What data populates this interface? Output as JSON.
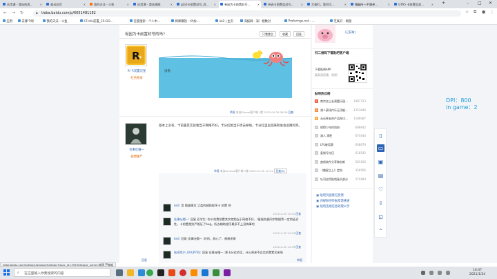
{
  "browser": {
    "tabs": [
      {
        "label": "应用课 - 我站的男…",
        "color": "#2e6fd6",
        "active": false
      },
      {
        "label": "驱动总页",
        "color": "#2e6fd6",
        "active": false
      },
      {
        "label": "我的天法 - 斗鱼",
        "color": "#ff6d00",
        "active": false
      },
      {
        "label": "应用课 - 我站观图",
        "color": "#2e6fd6",
        "active": false
      },
      {
        "label": "gta5卡前置封号_百…",
        "color": "#2e6fd6",
        "active": false
      },
      {
        "label": "有因为卡前置封号…",
        "color": "#2e6fd6",
        "active": true
      },
      {
        "label": "听说卡前置会封号…",
        "color": "#2e6fd6",
        "active": false
      },
      {
        "label": "大佬们，我问可…",
        "color": "#2e6fd6",
        "active": false
      },
      {
        "label": "镰鼬所一不属单…",
        "color": "#2e6fd6",
        "active": false
      },
      {
        "label": "GTA5 卡前置会封…",
        "color": "#2e6fd6",
        "active": false
      }
    ],
    "url": "tieba.baidu.com/p/6651481182",
    "bookmarks": [
      "应用",
      "去哪个网",
      "我的天法 - 斗鱼",
      "CF/cfu前置_CS:GO…",
      "百度搜索 - 个人中…",
      "网课赚钱 - YA加…",
      "lol2 | 主页",
      "海报网 - 海！相数对",
      "Proferings.net - …",
      "芝联开 - 网盘"
    ],
    "status_url": "tieba.baidu.com/hottopic/browse/hottopic?topic_id=39335&topic_name=新闻 芦格喵"
  },
  "thread": {
    "title": "有因为卡前置封号的吗?",
    "buttons": {
      "only_op": "只看楼主",
      "collect": "收藏",
      "reply": "回复"
    },
    "post1": {
      "user": "R*卡前置汉堡",
      "level": "红色牧家",
      "img_caption": "没有",
      "report": "举报",
      "device": "来自iPhone客户端",
      "floor": "1楼",
      "time": "2020-04-30 08:38",
      "reply_label": "回复"
    },
    "post2": {
      "user": "佳事吐帽一",
      "level": "鹿嚼僵尸",
      "text": "基本上没有，卡前置其实就相当于网络不好，卡分红相当于周去掉线，卡分红里主回来和坐会追赠的奖。",
      "report": "举报",
      "device": "来自Android客户端",
      "floor": "2楼",
      "time": "2020-04-30 12:21",
      "reply_label": "回复(5)"
    },
    "subreplies": [
      {
        "user": "bsd",
        "text": "用 镜盒模页 之类的辅助程序卡 前置 吧",
        "time": "2020-4-30 14:31",
        "action": "回复"
      },
      {
        "user": "佳事吐帽一",
        "text": "回复 亚学生 :你卡免费前置其实就相当于网络不好，r星服务器同步数据等一定的延迟性，卡前置类别严格证了bug。所去辅助程序最多不上没嗨事吧",
        "time": "2020-4-30 14:33",
        "action": "回复"
      },
      {
        "user": "bsd",
        "text": "回复 佳事吐帽一 :好的，放心了，谢谢老哥",
        "time": "2020-4-30 14:39",
        "action": "回复"
      },
      {
        "user": "贴吧用户_GtXjP7Bz",
        "text": "回复 佳事吐帽一 :那卡分红的话，什么原来不会卖前置累扣来呀",
        "time": "2020-5-23 16:57",
        "action": "回复"
      }
    ],
    "more_btn": "我也说一句",
    "footer_left": "回复",
    "footer_right": "举报"
  },
  "sidebar": {
    "user": "(已获取)",
    "qr_title": "扫二维码下载贴吧客户端",
    "qr_lines": [
      "下载贴吧APP",
      "看高清直播、视频!"
    ],
    "hot_title": "贴吧热议榜",
    "hot": [
      {
        "rank": "1",
        "title": "南京红山长颈鹿乐园…",
        "value": "1487723",
        "color": "#f55a3c"
      },
      {
        "rank": "2",
        "title": "湖人豪场作乐无功能…",
        "value": "1253646",
        "color": "#f58a3c"
      },
      {
        "rank": "3",
        "title": "无论杯友的产品探讨…",
        "value": "1186087",
        "color": "#f5a83c"
      },
      {
        "rank": "4",
        "title": "缘得少年你别扮",
        "value": "688842",
        "color": "#c7c7c7"
      },
      {
        "rank": "5",
        "title": "湖人 再胜",
        "value": "674444",
        "color": "#c7c7c7"
      },
      {
        "rank": "6",
        "title": "LPL被话题",
        "value": "608670",
        "color": "#c7c7c7"
      },
      {
        "rank": "7",
        "title": "复制号光伍",
        "value": "618542",
        "color": "#c7c7c7"
      },
      {
        "rank": "8",
        "title": "曲线软件分享做创新",
        "value": "501106",
        "color": "#c7c7c7"
      },
      {
        "rank": "9",
        "title": "《傲星之上》定档",
        "value": "358566",
        "color": "#c7c7c7"
      },
      {
        "rank": "10",
        "title": "吐司应用贴吧接头部分",
        "value": "274484",
        "color": "#c7c7c7"
      }
    ],
    "links": [
      "贴吧页面意见反馈",
      "违规贴吧举报反馈通道",
      "贴吧违规信息处理公示"
    ]
  },
  "overlay": {
    "line1": "DPI：800",
    "line2": "in game：2"
  },
  "taskbar": {
    "search_placeholder": "在这里输入你要搜索的内容",
    "time": "10:47",
    "date": "2021/1/24"
  }
}
